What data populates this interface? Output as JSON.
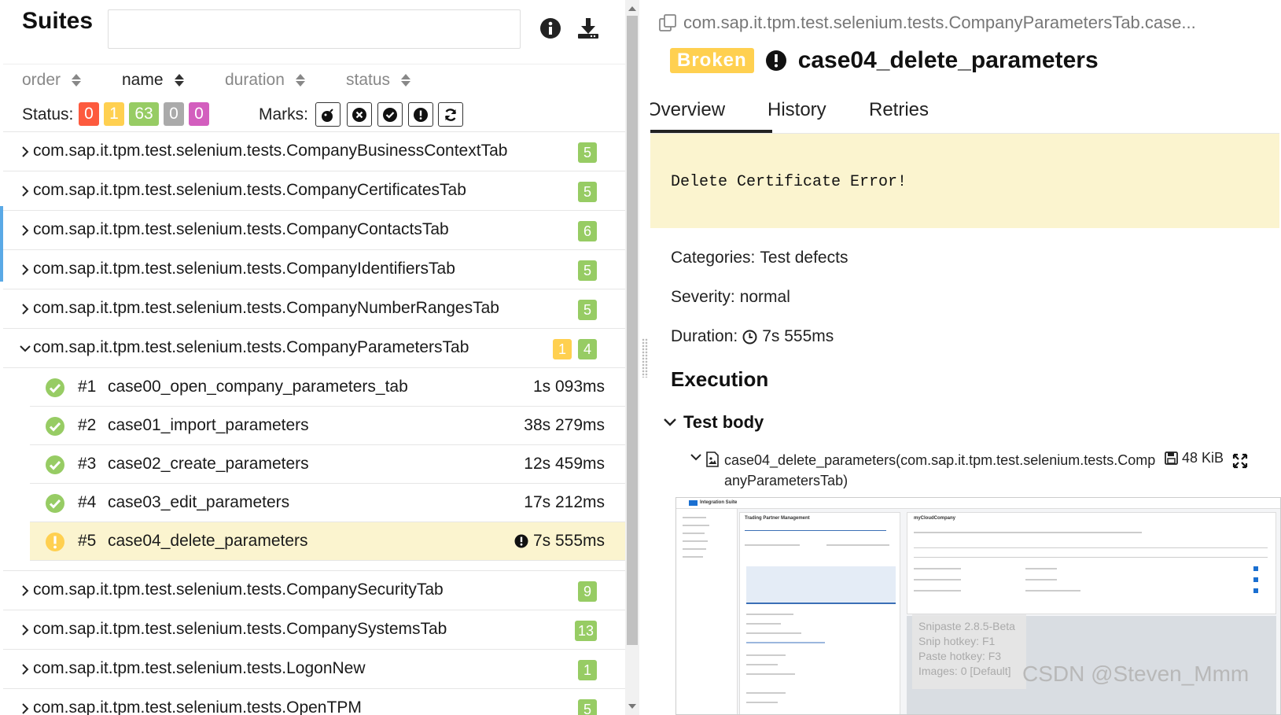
{
  "suites": {
    "title": "Suites",
    "search_placeholder": "",
    "info_icon": "info-icon",
    "download_icon": "download-icon"
  },
  "sort": {
    "order": "order",
    "name": "name",
    "duration": "duration",
    "status": "status"
  },
  "status_filter": {
    "label": "Status:",
    "chips": [
      {
        "value": "0",
        "color": "#fd5a3e"
      },
      {
        "value": "1",
        "color": "#ffd050"
      },
      {
        "value": "63",
        "color": "#97cc64"
      },
      {
        "value": "0",
        "color": "#aaaaaa"
      },
      {
        "value": "0",
        "color": "#d35ebe"
      }
    ]
  },
  "marks": {
    "label": "Marks:",
    "icons": [
      "bomb-icon",
      "times-circle-icon",
      "check-circle-icon",
      "exclamation-circle-icon",
      "refresh-icon"
    ]
  },
  "tree": {
    "suites_before": [
      {
        "name": "com.sap.it.tpm.test.selenium.tests.CompanyBusinessContextTab",
        "green": "5"
      },
      {
        "name": "com.sap.it.tpm.test.selenium.tests.CompanyCertificatesTab",
        "green": "5"
      },
      {
        "name": "com.sap.it.tpm.test.selenium.tests.CompanyContactsTab",
        "green": "6"
      },
      {
        "name": "com.sap.it.tpm.test.selenium.tests.CompanyIdentifiersTab",
        "green": "5"
      },
      {
        "name": "com.sap.it.tpm.test.selenium.tests.CompanyNumberRangesTab",
        "green": "5"
      }
    ],
    "expanded": {
      "name": "com.sap.it.tpm.test.selenium.tests.CompanyParametersTab",
      "yellow": "1",
      "green": "4",
      "cases": [
        {
          "num": "#1",
          "name": "case00_open_company_parameters_tab",
          "duration": "1s 093ms",
          "status": "passed"
        },
        {
          "num": "#2",
          "name": "case01_import_parameters",
          "duration": "38s 279ms",
          "status": "passed"
        },
        {
          "num": "#3",
          "name": "case02_create_parameters",
          "duration": "12s 459ms",
          "status": "passed"
        },
        {
          "num": "#4",
          "name": "case03_edit_parameters",
          "duration": "17s 212ms",
          "status": "passed"
        },
        {
          "num": "#5",
          "name": "case04_delete_parameters",
          "duration": "7s 555ms",
          "status": "broken"
        }
      ]
    },
    "suites_after": [
      {
        "name": "com.sap.it.tpm.test.selenium.tests.CompanySecurityTab",
        "green": "9"
      },
      {
        "name": "com.sap.it.tpm.test.selenium.tests.CompanySystemsTab",
        "green": "13"
      },
      {
        "name": "com.sap.it.tpm.test.selenium.tests.LogonNew",
        "green": "1"
      },
      {
        "name": "com.sap.it.tpm.test.selenium.tests.OpenTPM",
        "green": "5"
      }
    ]
  },
  "detail": {
    "breadcrumb": "com.sap.it.tpm.test.selenium.tests.CompanyParametersTab.case...",
    "status_badge": "Broken",
    "title": "case04_delete_parameters",
    "tabs": [
      "Overview",
      "History",
      "Retries"
    ],
    "active_tab": "Overview",
    "error_message": "Delete Certificate Error!",
    "categories_label": "Categories:",
    "categories_value": "Test defects",
    "severity_label": "Severity:",
    "severity_value": "normal",
    "duration_label": "Duration:",
    "duration_value": "7s 555ms",
    "execution_title": "Execution",
    "test_body_label": "Test body",
    "attachment_name": "case04_delete_parameters(com.sap.it.tpm.test.selenium.tests.CompanyParametersTab)",
    "attachment_size": "48 KiB"
  },
  "screenshot_overlay": {
    "app_title": "Integration Suite",
    "panel_title": "Trading Partner Management",
    "company": "myCloudCompany",
    "snipaste_lines": [
      "Snipaste 2.8.5-Beta",
      "Snip hotkey: F1",
      "Paste hotkey: F3",
      "Images: 0 [Default]"
    ],
    "watermark": "CSDN @Steven_Mmm"
  },
  "colors": {
    "passed": "#97cc64",
    "broken": "#ffd050",
    "failed": "#fd5a3e",
    "selected_row": "#fbf4cf"
  }
}
